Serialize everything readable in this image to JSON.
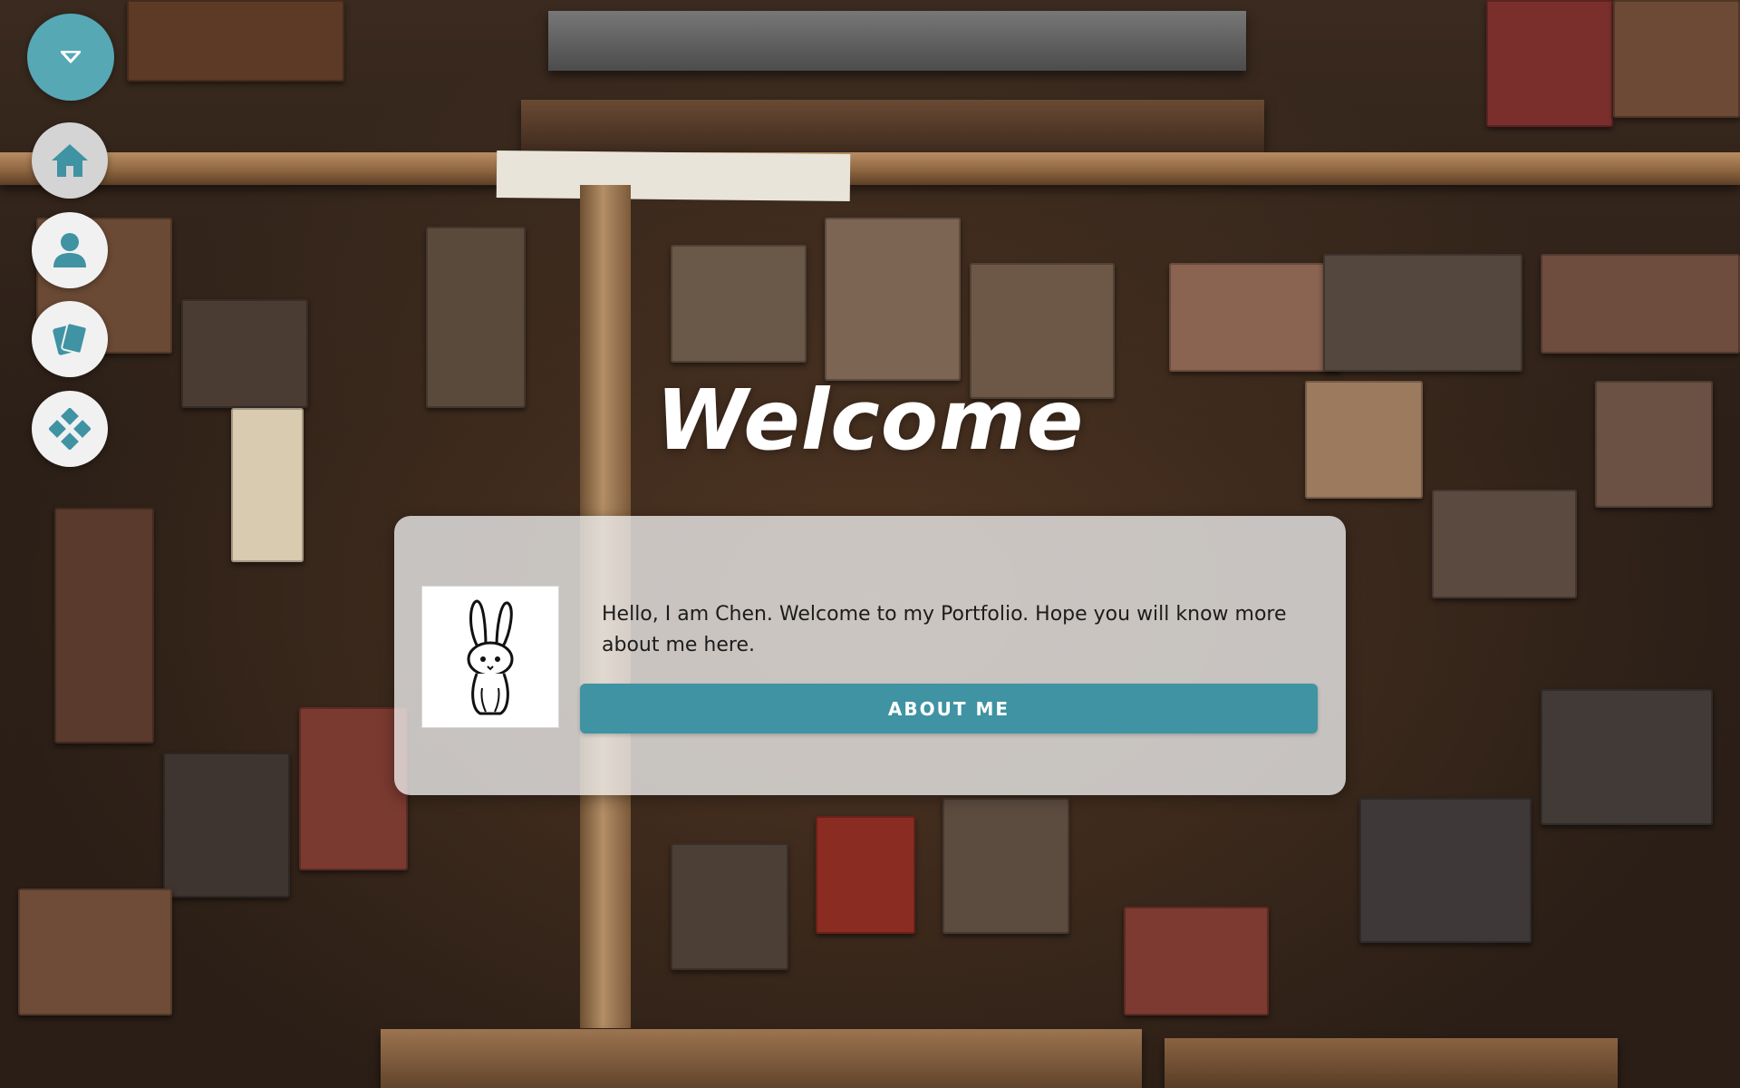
{
  "nav": {
    "items": [
      {
        "id": "toggle",
        "icon": "caret-down-icon",
        "color": "#56a8b5"
      },
      {
        "id": "home",
        "icon": "home-icon",
        "color": "#3f93a3"
      },
      {
        "id": "about",
        "icon": "person-icon",
        "color": "#3f93a3"
      },
      {
        "id": "portfolio",
        "icon": "cards-icon",
        "color": "#3f93a3"
      },
      {
        "id": "skills",
        "icon": "diamond-icon",
        "color": "#3f93a3"
      }
    ]
  },
  "hero": {
    "title": "Welcome"
  },
  "card": {
    "avatar_icon": "bunny-icon",
    "intro": "Hello, I am Chen. Welcome to my Portfolio. Hope you will know more about me here.",
    "button_label": "ABOUT ME",
    "button_color": "#3f93a3"
  }
}
